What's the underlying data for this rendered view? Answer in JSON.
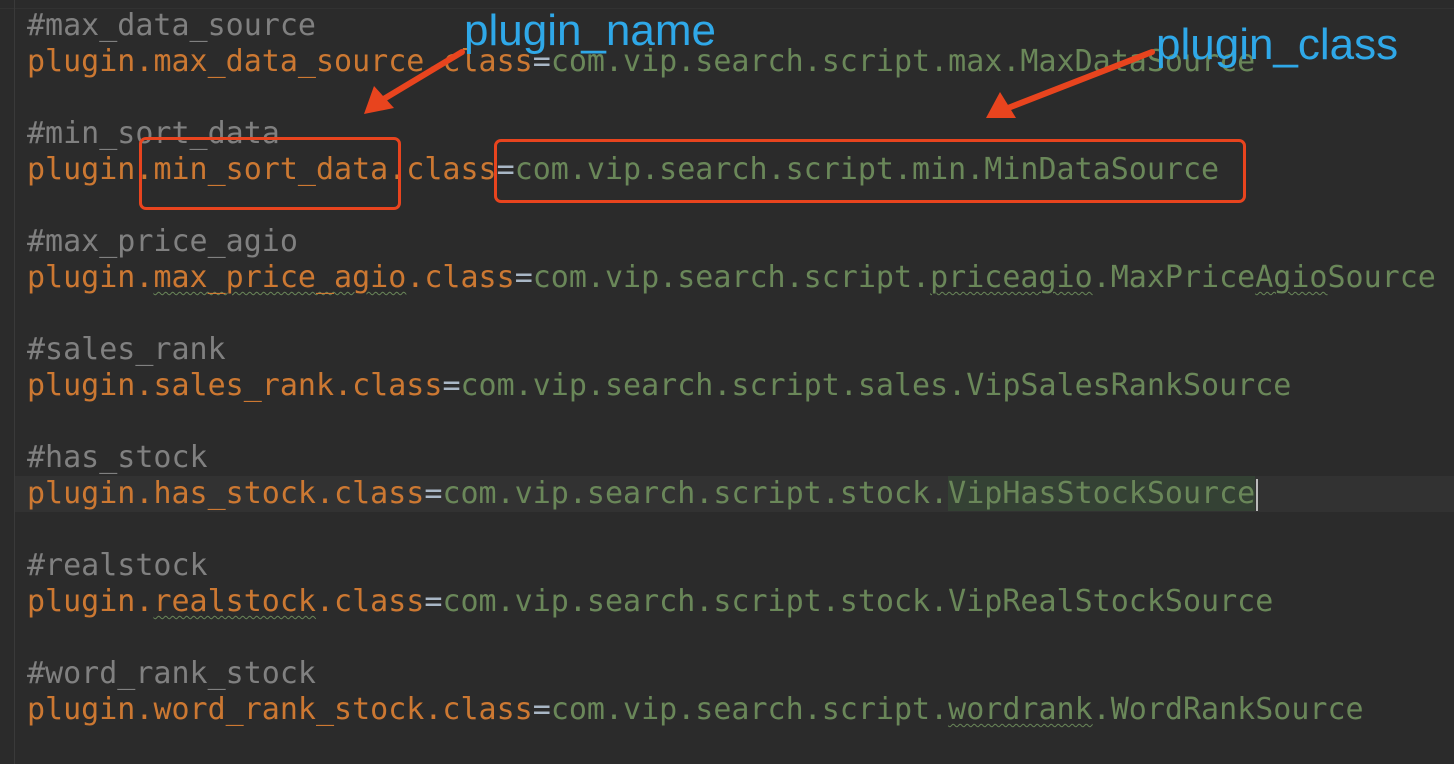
{
  "editor": {
    "blocks": [
      {
        "comment": "#max_data_source",
        "prefix": "plugin.",
        "name": "max_data_source",
        "suffix": ".class",
        "eq": "=",
        "value": "com.vip.search.script.max.MaxDataSource"
      },
      {
        "comment": "#min_sort_data",
        "prefix": "plugin.",
        "name": "min_sort_data",
        "suffix": ".class",
        "eq": "=",
        "value": "com.vip.search.script.min.MinDataSource"
      },
      {
        "comment": "#max_price_agio",
        "prefix": "plugin.",
        "name": "max_price_agio",
        "suffix": ".class",
        "eq": "=",
        "value_a": "com.vip.search.script.",
        "value_b": "priceagio",
        "value_c": ".MaxPrice",
        "value_d": "Agio",
        "value_e": "Source"
      },
      {
        "comment": "#sales_rank",
        "prefix": "plugin.",
        "name": "sales_rank",
        "suffix": ".class",
        "eq": "=",
        "value": "com.vip.search.script.sales.VipSalesRankSource"
      },
      {
        "comment": "#has_stock",
        "prefix": "plugin.",
        "name": "has_stock",
        "suffix": ".class",
        "eq": "=",
        "value_a": "com.vip.search.script.stock.",
        "value_b": "VipHasStockSource"
      },
      {
        "comment": "#realstock",
        "prefix": "plugin.",
        "name": "realstock",
        "suffix": ".class",
        "eq": "=",
        "value": "com.vip.search.script.stock.VipRealStockSource"
      },
      {
        "comment": "#word_rank_stock",
        "prefix": "plugin.",
        "name": "word_rank_stock",
        "suffix": ".class",
        "eq": "=",
        "value_a": "com.vip.search.script.",
        "value_b": "wordrank",
        "value_c": ".WordRankSource"
      }
    ]
  },
  "annotations": {
    "plugin_name_label": "plugin_name",
    "plugin_class_label": "plugin_class",
    "color_box": "#e8441e",
    "color_label": "#2fa8e8"
  },
  "colors": {
    "background": "#2b2b2b",
    "comment": "#808080",
    "keyword": "#cc7832",
    "string_value": "#6a8759"
  }
}
